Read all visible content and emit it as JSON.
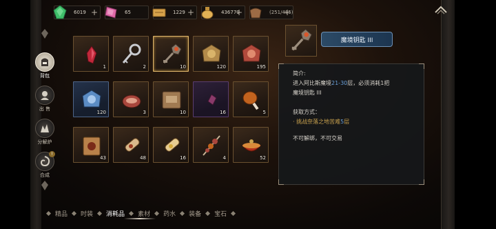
{
  "resources": [
    {
      "icon": "green-gem-icon",
      "value": "6019",
      "color": "#3fbf6a"
    },
    {
      "icon": "pink-crystal-icon",
      "value": "65",
      "color": "#e06aa8"
    },
    {
      "icon": "gold-ticket-icon",
      "value": "1229",
      "color": "#d7a24a"
    },
    {
      "icon": "gold-coin-bag-icon",
      "value": "436779",
      "color": "#e2b255"
    },
    {
      "icon": "leather-bag-icon",
      "value": "(251/485)",
      "color": "#9c6b45"
    }
  ],
  "sidenav": [
    {
      "name": "nav-backpack",
      "icon": "backpack-icon",
      "label": "背包",
      "active": true
    },
    {
      "name": "nav-sell",
      "icon": "sell-icon",
      "label": "出 售",
      "active": false
    },
    {
      "name": "nav-dismantle",
      "icon": "dismantle-icon",
      "label": "分解炉",
      "active": false
    },
    {
      "name": "nav-synthesis",
      "icon": "synthesis-icon",
      "label": "合成",
      "active": false,
      "badge": "!"
    }
  ],
  "items": [
    {
      "icon": "red-crystal-icon",
      "qty": "1"
    },
    {
      "icon": "silver-key-icon",
      "qty": "2"
    },
    {
      "icon": "demon-key-icon",
      "qty": "10",
      "selected": true
    },
    {
      "icon": "gold-emblem-icon",
      "qty": "120"
    },
    {
      "icon": "red-emblem-icon",
      "qty": "195"
    },
    {
      "icon": "blue-emblem-icon",
      "qty": "120"
    },
    {
      "icon": "raw-meat-icon",
      "qty": "3"
    },
    {
      "icon": "item-pack-icon",
      "qty": "10"
    },
    {
      "icon": "purple-shard-icon",
      "qty": "16"
    },
    {
      "icon": "roast-drumstick-icon",
      "qty": "5"
    },
    {
      "icon": "fortune-bag-icon",
      "qty": "43"
    },
    {
      "icon": "scroll-icon",
      "qty": "48"
    },
    {
      "icon": "treasure-scroll-icon",
      "qty": "16"
    },
    {
      "icon": "meat-skewer-icon",
      "qty": "4"
    },
    {
      "icon": "bowl-icon",
      "qty": "52"
    }
  ],
  "detail": {
    "icon": "demon-key-icon",
    "name": "魔境钥匙 III",
    "intro_label": "简介:",
    "desc_1": "进入阿比斯魔境",
    "desc_floors": "21-30",
    "desc_2": "层，必须消耗1把",
    "desc_key": "魔境钥匙 III",
    "obtain_label": "获取方式：",
    "obtain_pre": "· 挑战奈落之地苦难",
    "obtain_num": "5",
    "obtain_post": "层",
    "restriction": "不可解绑，不可交易"
  },
  "tabs": [
    {
      "label": "精品",
      "active": false
    },
    {
      "label": "时装",
      "active": false
    },
    {
      "label": "消耗品",
      "active": true
    },
    {
      "label": "素材",
      "active": false
    },
    {
      "label": "药水",
      "active": false
    },
    {
      "label": "装备",
      "active": false
    },
    {
      "label": "宝石",
      "active": false
    }
  ]
}
